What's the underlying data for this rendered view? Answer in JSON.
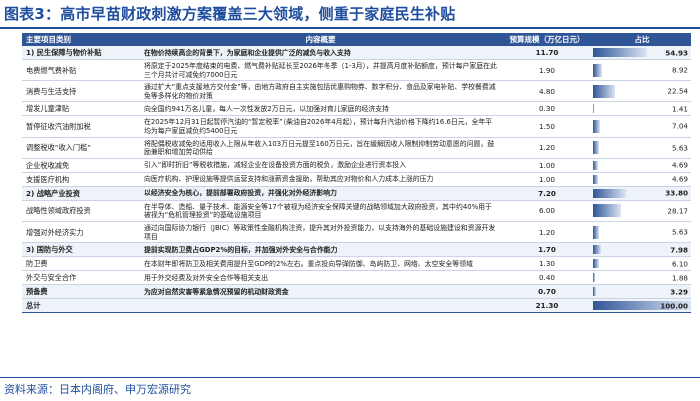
{
  "title": "图表3：高市早苗财政刺激方案覆盖三大领域，侧重于家庭民生补贴",
  "source": "资料来源：日本内阁府、申万宏源研究",
  "colors": {
    "accent": "#1f4e9e",
    "header_bg": "#2f5597",
    "row_highlight": "#eef2f9"
  },
  "table": {
    "headers": [
      "主要项目类别",
      "内容概要",
      "预算规模（万亿日元）",
      "占比"
    ],
    "rows": [
      {
        "kind": "cat",
        "item": "1) 民生保障与物价补贴",
        "desc": "在物价持续高企的背景下，为家庭和企业提供广泛的减负与收入支持",
        "budget": "11.70",
        "share": "54.93",
        "share_value": 54.93
      },
      {
        "kind": "sub",
        "item": "电费燃气费补贴",
        "desc": "将原定于2025年度结束的电费、燃气费补贴延长至2026年冬季（1-3月），并提高月度补贴额度，预计每户家庭在此三个月共计可减免约7000日元",
        "budget": "1.90",
        "share": "8.92",
        "share_value": 8.92
      },
      {
        "kind": "sub",
        "item": "消费与生活支持",
        "desc": "通过扩大“重点支援地方交付金”等，由地方政府自主实施包括优惠购物券、数字积分、食品及家电补贴、学校餐费减免等多样化的物价对策",
        "budget": "4.80",
        "share": "22.54",
        "share_value": 22.54
      },
      {
        "kind": "sub",
        "item": "增发儿童津贴",
        "desc": "向全国约941万名儿童，每人一次性发放2万日元，以加强对育儿家庭的经济支持",
        "budget": "0.30",
        "share": "1.41",
        "share_value": 1.41
      },
      {
        "kind": "sub",
        "item": "暂停征收汽油附加税",
        "desc": "在2025年12月31日起暂停汽油的“暂定税率”（柴油自2026年4月起），预计每升汽油价格下降约16.6日元，全年平均为每户家庭减负约5400日元",
        "budget": "1.50",
        "share": "7.04",
        "share_value": 7.04
      },
      {
        "kind": "sub",
        "item": "调整税收“收入门槛”",
        "desc": "将配偶税收减免的适用收入上限从年收入103万日元提至160万日元，旨在缓解因收入限制抑制劳动意愿的问题，鼓励兼职和增加劳动供给",
        "budget": "1.20",
        "share": "5.63",
        "share_value": 5.63
      },
      {
        "kind": "sub",
        "item": "企业税收减免",
        "desc": "引入“即时折旧”等税收措施，减轻企业在设备投资方面的税负，激励企业进行资本投入",
        "budget": "1.00",
        "share": "4.69",
        "share_value": 4.69
      },
      {
        "kind": "sub",
        "item": "支援医疗机构",
        "desc": "向医疗机构、护理设施等提供运营支持和涨薪资金援助，帮助其应对物价和人力成本上涨的压力",
        "budget": "1.00",
        "share": "4.69",
        "share_value": 4.69
      },
      {
        "kind": "cat",
        "item": "2) 战略产业投资",
        "desc": "以经济安全为核心，提前部署政府投资，并强化对外经济影响力",
        "budget": "7.20",
        "share": "33.80",
        "share_value": 33.8
      },
      {
        "kind": "sub",
        "item": "战略性领域政府投资",
        "desc": "在半导体、造船、量子技术、能源安全等17个被视为经济安全保障关键的战略领域加大政府投资，其中约40%用于被视为“危机管理投资”的基础设施项目",
        "budget": "6.00",
        "share": "28.17",
        "share_value": 28.17
      },
      {
        "kind": "sub",
        "item": "增强对外经济实力",
        "desc": "通过向国际协力银行（JBIC）等政策性金融机构注资，提升其对外投资能力，以支持海外的基础设施建设和资源开发项目",
        "budget": "1.20",
        "share": "5.63",
        "share_value": 5.63
      },
      {
        "kind": "cat",
        "item": "3) 国防与外交",
        "desc": "提前实现防卫费占GDP2%的目标，并加强对外安全与合作能力",
        "budget": "1.70",
        "share": "7.98",
        "share_value": 7.98
      },
      {
        "kind": "sub",
        "item": "防卫费",
        "desc": "在本财年即将防卫及相关费用提升至GDP的2%左右。重点投向导弹防御、岛屿防卫、网络、太空安全等领域",
        "budget": "1.30",
        "share": "6.10",
        "share_value": 6.1
      },
      {
        "kind": "sub",
        "item": "外交与安全合作",
        "desc": "用于外交经费及对外安全合作等相关支出",
        "budget": "0.40",
        "share": "1.88",
        "share_value": 1.88
      },
      {
        "kind": "cat",
        "item": "预备费",
        "desc": "为应对自然灾害等紧急情况预留的机动财政资金",
        "budget": "0.70",
        "share": "3.29",
        "share_value": 3.29
      },
      {
        "kind": "total",
        "item": "总计",
        "desc": "",
        "budget": "21.30",
        "share": "100.00",
        "share_value": 100.0
      }
    ]
  }
}
